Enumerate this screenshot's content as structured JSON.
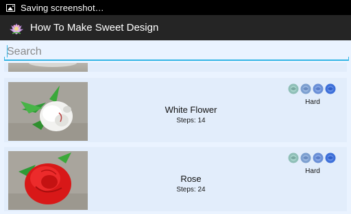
{
  "status_bar": {
    "notification": "Saving screenshot…",
    "icon": "image-icon"
  },
  "action_bar": {
    "title": "How To Make Sweet Design",
    "icon": "app-rose-icon"
  },
  "search": {
    "placeholder": "Search",
    "value": ""
  },
  "items": [
    {
      "name": "White Flower",
      "steps": "Steps: 14",
      "difficulty": "Hard",
      "rating": 4,
      "rating_max": 4,
      "thumbnail": "white-flower-photo"
    },
    {
      "name": "Rose",
      "steps": "Steps: 24",
      "difficulty": "Hard",
      "rating": 4,
      "rating_max": 4,
      "thumbnail": "red-rose-photo"
    }
  ],
  "colors": {
    "accent": "#33b5e5",
    "background": "#eaf3ff",
    "action_bar": "#252525"
  }
}
